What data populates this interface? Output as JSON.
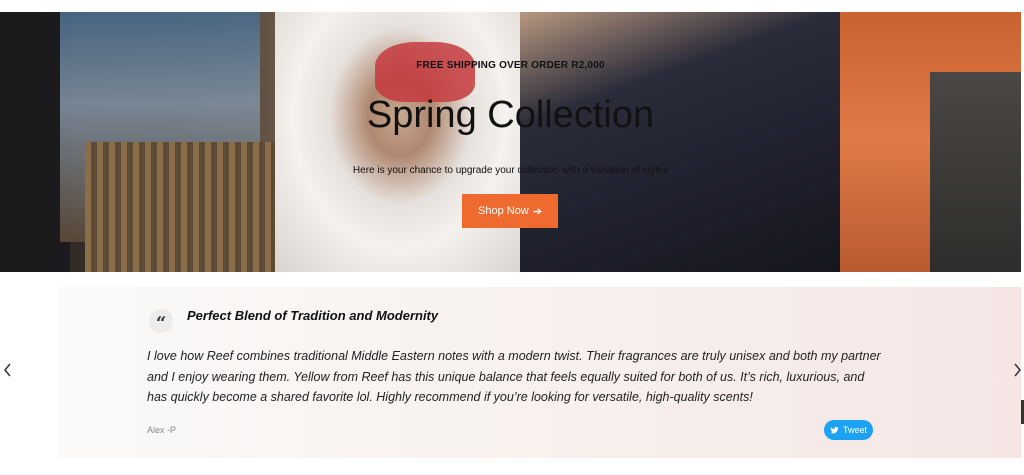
{
  "hero": {
    "shipping_notice": "FREE SHIPPING OVER ORDER R2,000",
    "title": "Spring Collection",
    "subtitle": "Here is your chance to upgrade your collection with a variation of styles",
    "shop_button": "Shop Now",
    "shop_button_arrow": "➔"
  },
  "testimonial": {
    "quote_icon": "quote-icon",
    "title": "Perfect Blend of Tradition and Modernity",
    "body": "I love how Reef combines traditional Middle Eastern notes with a modern twist. Their fragrances are truly unisex and both my partner and I enjoy wearing them. Yellow from Reef has this unique balance that feels equally suited for both of us. It’s rich, luxurious, and has quickly become a shared favorite lol. Highly recommend if you’re looking for versatile, high-quality scents!",
    "author": "Alex -P",
    "tweet_label": "Tweet"
  },
  "carousel": {
    "prev_icon": "chevron-left-icon",
    "next_icon": "chevron-right-icon"
  },
  "colors": {
    "accent": "#ef6a2e",
    "tweet": "#1da1f2"
  }
}
